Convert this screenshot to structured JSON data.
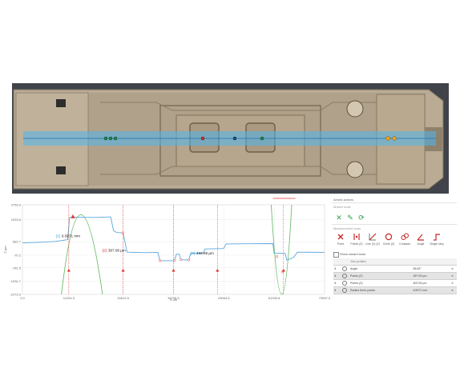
{
  "chart_data": {
    "type": "line",
    "xlabel": "X µm",
    "ylabel": "Z µm",
    "x_ticks": [
      "0.0",
      "11294.3",
      "24512.5",
      "36798.5",
      "49064.6",
      "61330.8",
      "73597.0"
    ],
    "y_ticks": [
      "2759.3",
      "1933.5",
      "681.7",
      "-70.2",
      "-781.5",
      "-1534.7",
      "-2273.9"
    ],
    "series": [
      {
        "values": [
          [
            0,
            620
          ],
          [
            4000,
            650
          ],
          [
            8000,
            700
          ],
          [
            11000,
            800
          ],
          [
            11500,
            2050
          ],
          [
            12500,
            2060
          ],
          [
            18000,
            2050
          ],
          [
            21500,
            2080
          ],
          [
            22200,
            1300
          ],
          [
            23000,
            1200
          ],
          [
            24500,
            1180
          ],
          [
            25500,
            100
          ],
          [
            30000,
            70
          ],
          [
            33000,
            80
          ],
          [
            33500,
            -380
          ],
          [
            37000,
            -380
          ],
          [
            37500,
            -20
          ],
          [
            38200,
            -20
          ],
          [
            38600,
            -330
          ],
          [
            40500,
            -340
          ],
          [
            41000,
            30
          ],
          [
            44000,
            40
          ],
          [
            44500,
            280
          ],
          [
            47000,
            290
          ],
          [
            49000,
            300
          ],
          [
            49600,
            560
          ],
          [
            55000,
            570
          ],
          [
            61000,
            580
          ],
          [
            61300,
            50
          ],
          [
            64000,
            30
          ],
          [
            64400,
            -350
          ],
          [
            66000,
            -200
          ],
          [
            67000,
            100
          ],
          [
            73597,
            90
          ]
        ]
      }
    ],
    "fits": [
      {
        "vertex": [
          14000,
          2200
        ],
        "left": [
          9500,
          -2273
        ],
        "right": [
          19500,
          -2273
        ]
      },
      {
        "vertex": [
          63200,
          -2273
        ],
        "left": [
          60600,
          2759
        ],
        "right": [
          65600,
          2759
        ]
      }
    ],
    "annotations": [
      {
        "id": "[1]",
        "text": "6.5971 mm"
      },
      {
        "id": "[2]",
        "text": "397.09 µm"
      },
      {
        "id": "[3]",
        "text": "402.59 µm"
      }
    ],
    "markers_x": [
      11294.3,
      24512.5,
      36798.5,
      47500,
      63600
    ]
  },
  "panel": {
    "title": "Aimed actions",
    "subtitle": "Motion tools",
    "section_label": "Measurement tools",
    "tools": [
      {
        "label": "Point"
      },
      {
        "label": "Points (Z)"
      },
      {
        "label": "Line (X) (Z)"
      },
      {
        "label": "Circle (Z)"
      },
      {
        "label": "Contacts"
      },
      {
        "label": "Angle"
      },
      {
        "label": "Single step"
      }
    ],
    "checkbox_label": "Show wizard tools",
    "table_header": {
      "col1": "Your profiles"
    },
    "rows": [
      {
        "name": "Angle",
        "value": "59.83°"
      },
      {
        "name": "Points (Z)",
        "value": "397.09 µm"
      },
      {
        "name": "Points (Z)",
        "value": "402.59 µm"
      },
      {
        "name": "Radius three points",
        "value": "6.5971 mm"
      }
    ]
  },
  "colors": {
    "profile": "#5aa6dc",
    "fit": "#6bbd6b",
    "marker": "#e53935",
    "scan_band": "#4fb6f0",
    "tool_red": "#c62828",
    "tool_green": "#2e9d47"
  }
}
